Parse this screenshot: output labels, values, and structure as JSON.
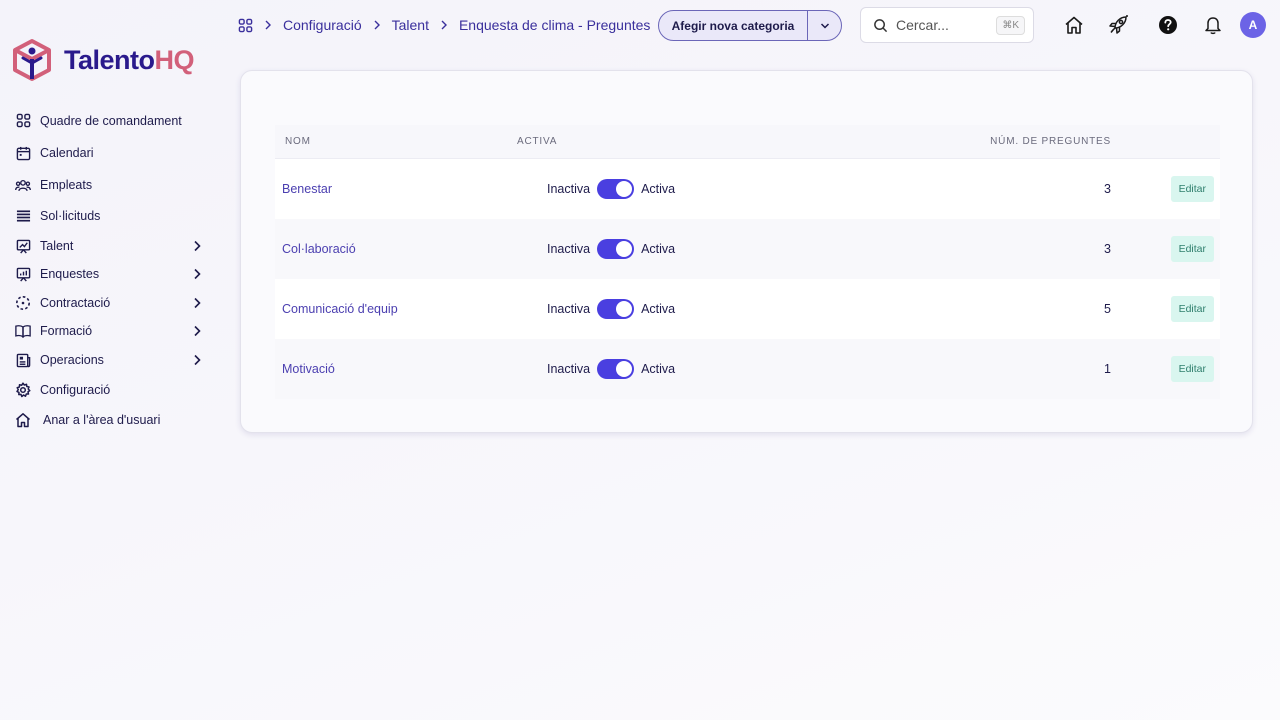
{
  "app": {
    "logo_part1": "Talento",
    "logo_part2": "HQ",
    "accent": "#4a3fe0",
    "brand_dark": "#2a1a8c",
    "brand_pink": "#d2607a"
  },
  "sidebar": {
    "items": [
      {
        "label": "Quadre de comandament",
        "icon": "grid-icon",
        "has_submenu": false
      },
      {
        "label": "Calendari",
        "icon": "calendar-icon",
        "has_submenu": false
      },
      {
        "label": "Empleats",
        "icon": "users-icon",
        "has_submenu": false
      },
      {
        "label": "Sol·licituds",
        "icon": "list-icon",
        "has_submenu": false
      },
      {
        "label": "Talent",
        "icon": "presentation-icon",
        "has_submenu": true
      },
      {
        "label": "Enquestes",
        "icon": "chart-board-icon",
        "has_submenu": true
      },
      {
        "label": "Contractació",
        "icon": "dashed-circle-icon",
        "has_submenu": true
      },
      {
        "label": "Formació",
        "icon": "book-icon",
        "has_submenu": true
      },
      {
        "label": "Operacions",
        "icon": "newspaper-icon",
        "has_submenu": true
      },
      {
        "label": "Configuració",
        "icon": "gear-icon",
        "has_submenu": false
      },
      {
        "label": "Anar a l'àrea d'usuari",
        "icon": "home-icon",
        "has_submenu": false
      }
    ]
  },
  "breadcrumb": [
    "Configuració",
    "Talent",
    "Enquesta de clima - Preguntes"
  ],
  "toolbar": {
    "add_category_label": "Afegir nova categoria"
  },
  "search": {
    "placeholder": "Cercar...",
    "shortcut": "⌘K"
  },
  "user": {
    "avatar_initial": "A"
  },
  "table": {
    "headers": {
      "name": "Nom",
      "active": "Activa",
      "count": "Núm. de preguntes"
    },
    "toggle_off_label": "Inactiva",
    "toggle_on_label": "Activa",
    "edit_label": "Editar",
    "rows": [
      {
        "name": "Benestar",
        "active": true,
        "count": "3"
      },
      {
        "name": "Col·laboració",
        "active": true,
        "count": "3"
      },
      {
        "name": "Comunicació d'equip",
        "active": true,
        "count": "5"
      },
      {
        "name": "Motivació",
        "active": true,
        "count": "1"
      }
    ]
  }
}
